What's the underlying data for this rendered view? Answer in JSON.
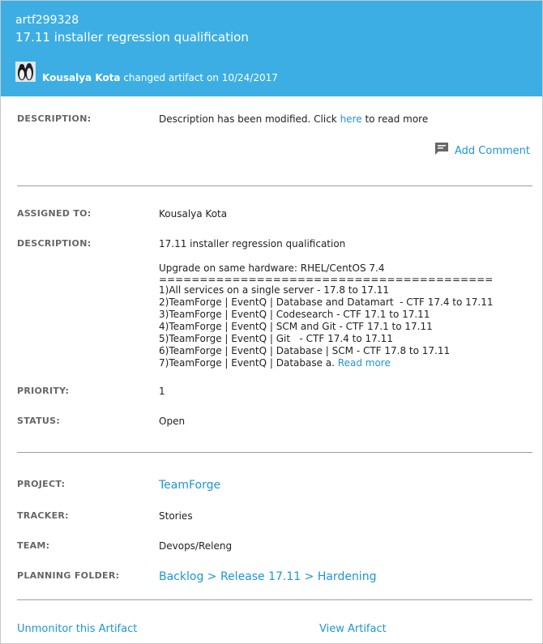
{
  "header": {
    "artifact_id": "artf299328",
    "title": "17.11 installer regression qualification",
    "user": "Kousalya Kota",
    "action": "changed artifact on 10/24/2017"
  },
  "change": {
    "label": "DESCRIPTION:",
    "text_before": "Description has been modified. Click ",
    "link": "here",
    "text_after": " to read more"
  },
  "add_comment": {
    "label": "Add Comment",
    "icon": "comment-icon"
  },
  "fields": {
    "assigned_to": {
      "label": "ASSIGNED TO:",
      "value": "Kousalya Kota"
    },
    "description": {
      "label": "DESCRIPTION:",
      "lines": [
        "17.11 installer regression qualification",
        "",
        "Upgrade on same hardware: RHEL/CentOS 7.4",
        "=========================================",
        "1)All services on a single server - 17.8 to 17.11",
        "2)TeamForge | EventQ | Database and Datamart  - CTF 17.4 to 17.11",
        "3)TeamForge | EventQ | Codesearch - CTF 17.1 to 17.11",
        "4)TeamForge | EventQ | SCM and Git - CTF 17.1 to 17.11",
        "5)TeamForge | EventQ | Git   - CTF 17.4 to 17.11",
        "6)TeamForge | EventQ | Database | SCM - CTF 17.8 to 17.11"
      ],
      "last_line": "7)TeamForge | EventQ | Database a. ",
      "read_more": "Read more"
    },
    "priority": {
      "label": "PRIORITY:",
      "value": "1"
    },
    "status": {
      "label": "STATUS:",
      "value": "Open"
    },
    "project": {
      "label": "PROJECT:",
      "value": "TeamForge"
    },
    "tracker": {
      "label": "TRACKER:",
      "value": "Stories"
    },
    "team": {
      "label": "TEAM:",
      "value": "Devops/Releng"
    },
    "planning_folder": {
      "label": "PLANNING FOLDER:",
      "value": "Backlog > Release 17.11 > Hardening"
    }
  },
  "footer": {
    "unmonitor": "Unmonitor this Artifact",
    "view": "View Artifact"
  },
  "colors": {
    "header_bg": "#3daee3",
    "link": "#1e95d6",
    "label": "#666666"
  }
}
